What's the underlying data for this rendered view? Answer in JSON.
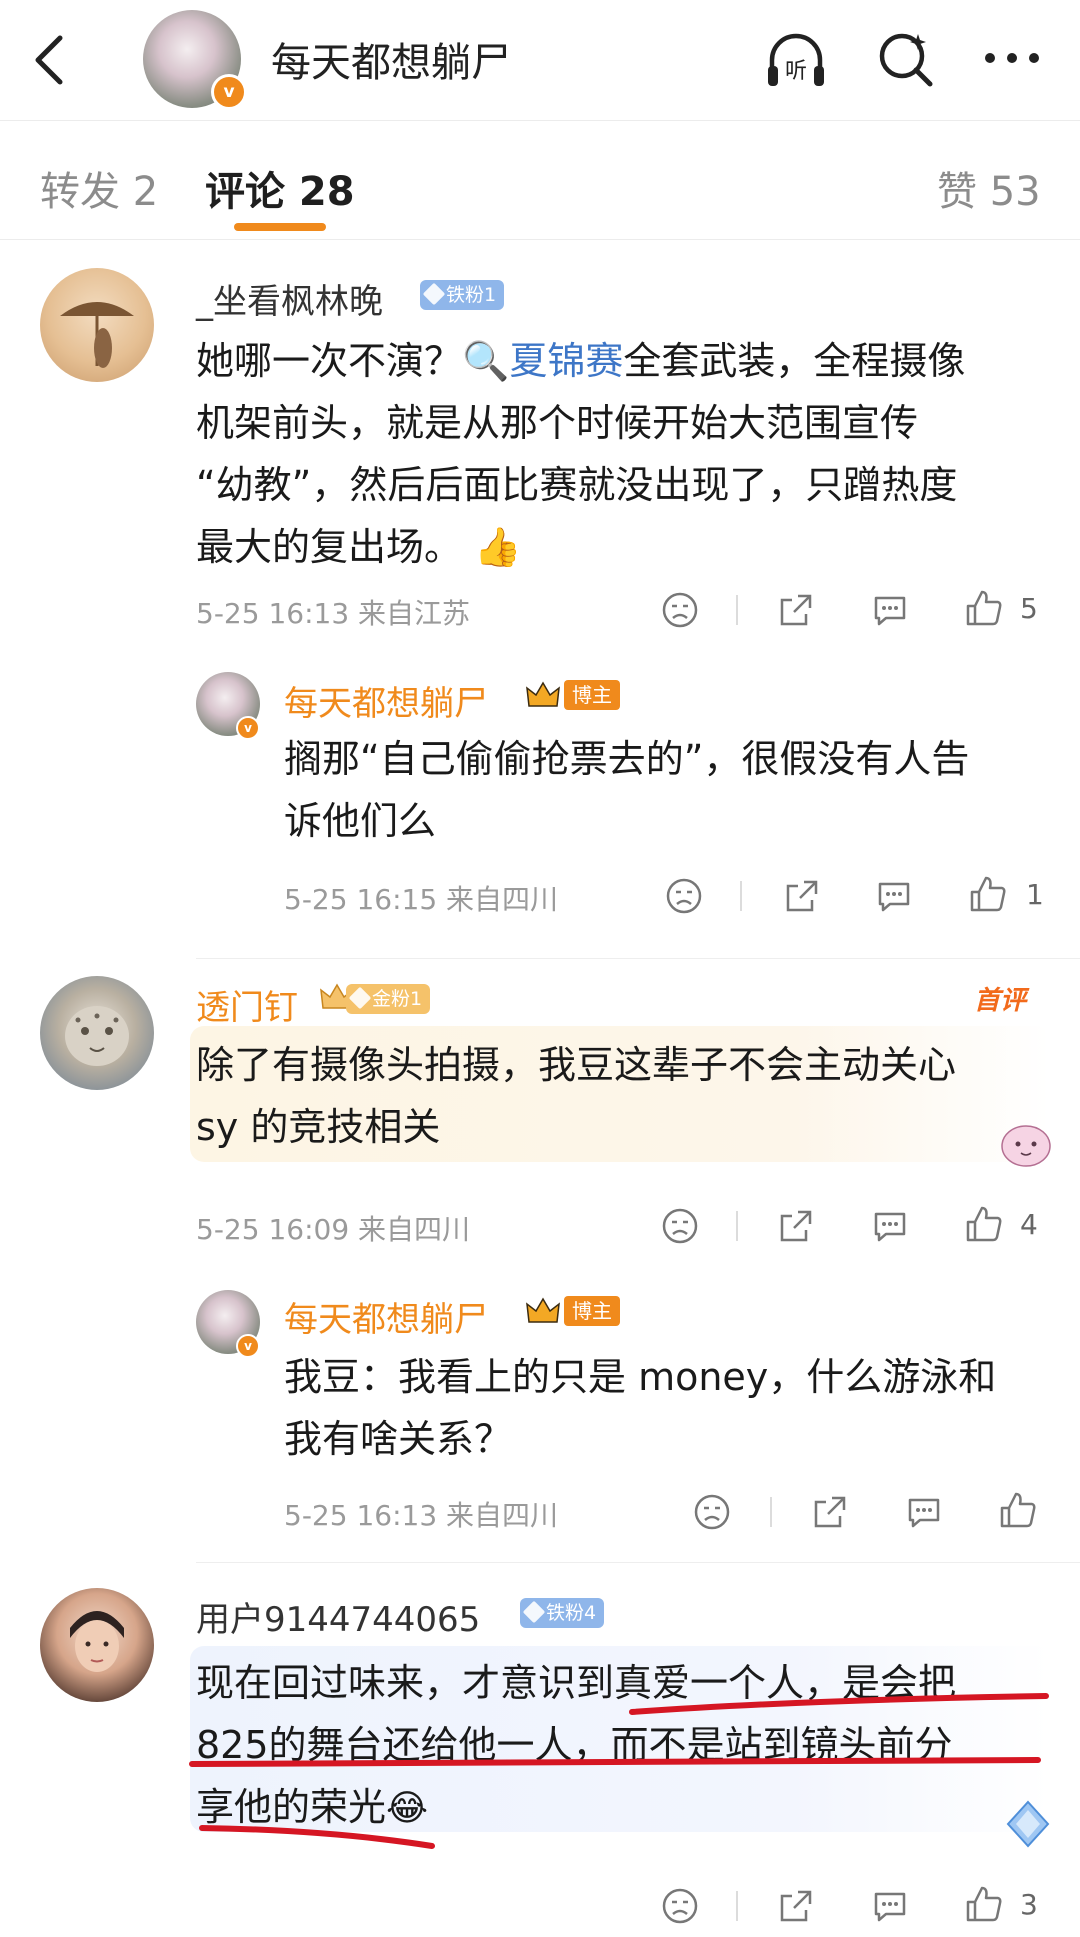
{
  "header": {
    "title": "每天都想躺尸",
    "listen_label": "听"
  },
  "tabs": [
    {
      "label": "转发 2"
    },
    {
      "label": "评论 28"
    },
    {
      "label": "赞 53"
    }
  ],
  "comments": [
    {
      "user": "_坐看枫林晚",
      "badge": "铁粉1",
      "text_before": "她哪一次不演？",
      "search_term": "夏锦赛",
      "text_after": "全套武装，全程摄像机架前头，就是从那个时候开始大范围宣传“幼教”，然后后面比赛就没出现了，只蹭热度最大的复出场。",
      "line1_rest": "全套武装，全程摄像",
      "line2": "机架前头，就是从那个时候开始大范围宣传",
      "line3": "“幼教”，然后后面比赛就没出现了，只蹭热度",
      "line4": "最大的复出场。",
      "meta": "5-25 16:13 来自江苏",
      "likes": "5"
    },
    {
      "user": "每天都想躺尸",
      "badge": "博主",
      "line1": "搁那“自己偷偷抢票去的”，很假没有人告",
      "line2": "诉他们么",
      "meta": "5-25 16:15 来自四川",
      "likes": "1"
    },
    {
      "user": "透门钉",
      "badge": "金粉1",
      "tag": "首评",
      "line1": "除了有摄像头拍摄，我豆这辈子不会主动关心",
      "line2": "sy 的竞技相关",
      "meta": "5-25 16:09 来自四川",
      "likes": "4"
    },
    {
      "user": "每天都想躺尸",
      "badge": "博主",
      "line1": "我豆：我看上的只是 money，什么游泳和",
      "line2": "我有啥关系？",
      "meta": "5-25 16:13 来自四川",
      "likes": ""
    },
    {
      "user": "用户9144744065",
      "badge": "铁粉4",
      "line1": "现在回过味来，才意识到真爱一个人，是会把",
      "line2": "825的舞台还给他一人，而不是站到镜头前分",
      "line3": "享他的荣光",
      "likes": "3"
    }
  ]
}
